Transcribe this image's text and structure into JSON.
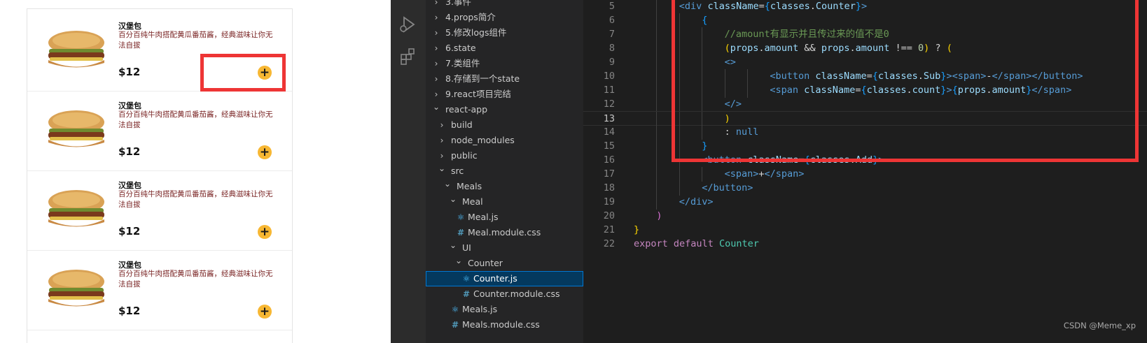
{
  "meals": [
    {
      "title": "汉堡包",
      "desc": "百分百纯牛肉搭配黄瓜番茄酱，经典滋味让你无法自拔",
      "price": "$12",
      "add": "+"
    },
    {
      "title": "汉堡包",
      "desc": "百分百纯牛肉搭配黄瓜番茄酱，经典滋味让你无法自拔",
      "price": "$12",
      "add": "+"
    },
    {
      "title": "汉堡包",
      "desc": "百分百纯牛肉搭配黄瓜番茄酱，经典滋味让你无法自拔",
      "price": "$12",
      "add": "+"
    },
    {
      "title": "汉堡包",
      "desc": "百分百纯牛肉搭配黄瓜番茄酱，经典滋味让你无法自拔",
      "price": "$12",
      "add": "+"
    }
  ],
  "activity_bar": {
    "icons": [
      "run-debug-icon",
      "extensions-icon"
    ]
  },
  "explorer": {
    "items": [
      {
        "label": "3.事件",
        "depth": 0,
        "kind": "folder",
        "open": false
      },
      {
        "label": "4.props简介",
        "depth": 0,
        "kind": "folder",
        "open": false
      },
      {
        "label": "5.修改logs组件",
        "depth": 0,
        "kind": "folder",
        "open": false
      },
      {
        "label": "6.state",
        "depth": 0,
        "kind": "folder",
        "open": false
      },
      {
        "label": "7.类组件",
        "depth": 0,
        "kind": "folder",
        "open": false
      },
      {
        "label": "8.存储到一个state",
        "depth": 0,
        "kind": "folder",
        "open": false
      },
      {
        "label": "9.react项目完结",
        "depth": 0,
        "kind": "folder",
        "open": false
      },
      {
        "label": "react-app",
        "depth": 0,
        "kind": "folder",
        "open": true
      },
      {
        "label": "build",
        "depth": 1,
        "kind": "folder",
        "open": false
      },
      {
        "label": "node_modules",
        "depth": 1,
        "kind": "folder",
        "open": false
      },
      {
        "label": "public",
        "depth": 1,
        "kind": "folder",
        "open": false
      },
      {
        "label": "src",
        "depth": 1,
        "kind": "folder",
        "open": true
      },
      {
        "label": "Meals",
        "depth": 2,
        "kind": "folder",
        "open": true
      },
      {
        "label": "Meal",
        "depth": 3,
        "kind": "folder",
        "open": true
      },
      {
        "label": "Meal.js",
        "depth": 4,
        "kind": "react"
      },
      {
        "label": "Meal.module.css",
        "depth": 4,
        "kind": "css"
      },
      {
        "label": "UI",
        "depth": 3,
        "kind": "folder",
        "open": true
      },
      {
        "label": "Counter",
        "depth": 4,
        "kind": "folder",
        "open": true
      },
      {
        "label": "Counter.js",
        "depth": 5,
        "kind": "react",
        "selected": true
      },
      {
        "label": "Counter.module.css",
        "depth": 5,
        "kind": "css"
      },
      {
        "label": "Meals.js",
        "depth": 3,
        "kind": "react"
      },
      {
        "label": "Meals.module.css",
        "depth": 3,
        "kind": "css"
      }
    ]
  },
  "editor": {
    "current_line": 13,
    "lines": [
      {
        "n": 5,
        "indent": 2,
        "tokens": [
          [
            "tag",
            "<div "
          ],
          [
            "attr",
            "className"
          ],
          [
            "pun",
            "="
          ],
          [
            "brace-b",
            "{"
          ],
          [
            "var",
            "classes"
          ],
          [
            "pun",
            "."
          ],
          [
            "var",
            "Counter"
          ],
          [
            "brace-b",
            "}"
          ],
          [
            "tag",
            ">"
          ]
        ]
      },
      {
        "n": 6,
        "indent": 3,
        "tokens": [
          [
            "brace-b",
            "{"
          ]
        ]
      },
      {
        "n": 7,
        "indent": 4,
        "tokens": [
          [
            "comment",
            "//amount有显示并且传过来的值不是0"
          ]
        ]
      },
      {
        "n": 8,
        "indent": 4,
        "tokens": [
          [
            "brace-y",
            "("
          ],
          [
            "var",
            "props"
          ],
          [
            "pun",
            "."
          ],
          [
            "var",
            "amount"
          ],
          [
            "pun",
            " && "
          ],
          [
            "var",
            "props"
          ],
          [
            "pun",
            "."
          ],
          [
            "var",
            "amount"
          ],
          [
            "pun",
            " !== "
          ],
          [
            "num",
            "0"
          ],
          [
            "brace-y",
            ")"
          ],
          [
            "pun",
            " ? "
          ],
          [
            "brace-y",
            "("
          ]
        ]
      },
      {
        "n": 9,
        "indent": 4,
        "tokens": [
          [
            "tag",
            "<>"
          ]
        ]
      },
      {
        "n": 10,
        "indent": 6,
        "tokens": [
          [
            "tag",
            "<button "
          ],
          [
            "attr",
            "className"
          ],
          [
            "pun",
            "="
          ],
          [
            "brace-b",
            "{"
          ],
          [
            "var",
            "classes"
          ],
          [
            "pun",
            "."
          ],
          [
            "var",
            "Sub"
          ],
          [
            "brace-b",
            "}"
          ],
          [
            "tag",
            ">"
          ],
          [
            "tag",
            "<span>"
          ],
          [
            "text",
            "-"
          ],
          [
            "tag",
            "</span>"
          ],
          [
            "tag",
            "</button>"
          ]
        ]
      },
      {
        "n": 11,
        "indent": 6,
        "tokens": [
          [
            "tag",
            "<span "
          ],
          [
            "attr",
            "className"
          ],
          [
            "pun",
            "="
          ],
          [
            "brace-b",
            "{"
          ],
          [
            "var",
            "classes"
          ],
          [
            "pun",
            "."
          ],
          [
            "var",
            "count"
          ],
          [
            "brace-b",
            "}"
          ],
          [
            "tag",
            ">"
          ],
          [
            "brace-b",
            "{"
          ],
          [
            "var",
            "props"
          ],
          [
            "pun",
            "."
          ],
          [
            "var",
            "amount"
          ],
          [
            "brace-b",
            "}"
          ],
          [
            "tag",
            "</span>"
          ]
        ]
      },
      {
        "n": 12,
        "indent": 4,
        "tokens": [
          [
            "tag",
            "</>"
          ]
        ]
      },
      {
        "n": 13,
        "indent": 4,
        "tokens": [
          [
            "brace-y",
            ")"
          ]
        ]
      },
      {
        "n": 14,
        "indent": 4,
        "tokens": [
          [
            "pun",
            ": "
          ],
          [
            "const",
            "null"
          ]
        ]
      },
      {
        "n": 15,
        "indent": 3,
        "tokens": [
          [
            "brace-b",
            "}"
          ]
        ]
      },
      {
        "n": 16,
        "indent": 3,
        "tokens": [
          [
            "tag",
            "<button "
          ],
          [
            "attr",
            "className"
          ],
          [
            "pun",
            "="
          ],
          [
            "brace-b",
            "{"
          ],
          [
            "var",
            "classes"
          ],
          [
            "pun",
            "."
          ],
          [
            "var",
            "Add"
          ],
          [
            "brace-b",
            "}"
          ],
          [
            "tag",
            ">"
          ]
        ]
      },
      {
        "n": 17,
        "indent": 4,
        "tokens": [
          [
            "tag",
            "<span>"
          ],
          [
            "text",
            "+"
          ],
          [
            "tag",
            "</span>"
          ]
        ]
      },
      {
        "n": 18,
        "indent": 3,
        "tokens": [
          [
            "tag",
            "</button>"
          ]
        ]
      },
      {
        "n": 19,
        "indent": 2,
        "tokens": [
          [
            "tag",
            "</div>"
          ]
        ]
      },
      {
        "n": 20,
        "indent": 1,
        "tokens": [
          [
            "brace-p",
            ")"
          ]
        ]
      },
      {
        "n": 21,
        "indent": 0,
        "tokens": [
          [
            "brace-y",
            "}"
          ]
        ]
      },
      {
        "n": 22,
        "indent": 0,
        "tokens": [
          [
            "kw",
            "export"
          ],
          [
            "pun",
            " "
          ],
          [
            "kw",
            "default"
          ],
          [
            "pun",
            " "
          ],
          [
            "cls",
            "Counter"
          ]
        ]
      }
    ]
  },
  "watermark": "CSDN @Meme_xp"
}
